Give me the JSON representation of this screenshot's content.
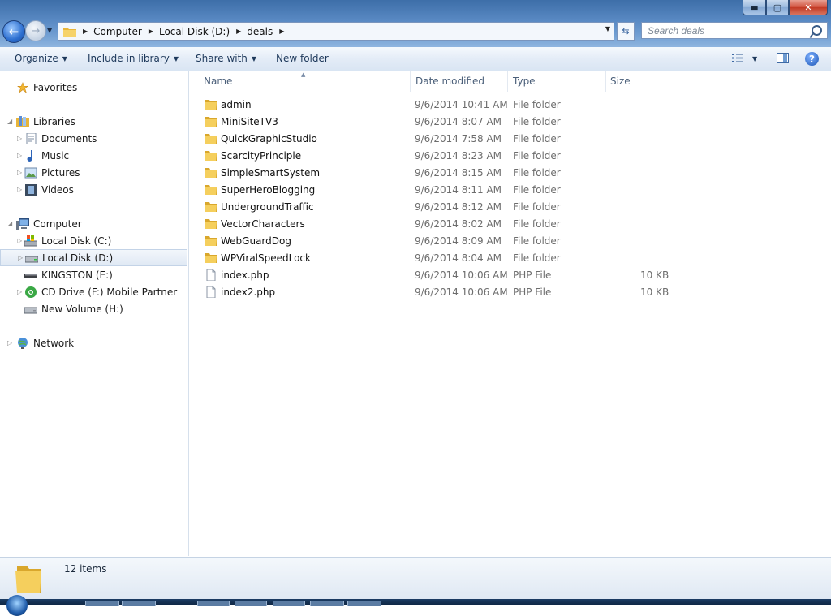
{
  "window": {
    "controls": {
      "minimize": "▬",
      "maximize": "▢",
      "close": "✕"
    }
  },
  "nav": {
    "back_icon": "back-arrow-icon",
    "forward_icon": "forward-arrow-icon"
  },
  "address": {
    "crumbs": [
      "Computer",
      "Local Disk (D:)",
      "deals"
    ]
  },
  "search": {
    "placeholder": "Search deals"
  },
  "toolbar": {
    "organize": "Organize",
    "include": "Include in library",
    "share": "Share with",
    "new_folder": "New folder"
  },
  "sidebar": {
    "favorites": "Favorites",
    "libraries": "Libraries",
    "documents": "Documents",
    "music": "Music",
    "pictures": "Pictures",
    "videos": "Videos",
    "computer": "Computer",
    "drive_c": "Local Disk (C:)",
    "drive_d": "Local Disk (D:)",
    "drive_e": "KINGSTON (E:)",
    "drive_f": "CD Drive (F:) Mobile Partner",
    "drive_h": "New Volume (H:)",
    "network": "Network"
  },
  "columns": {
    "name": "Name",
    "date": "Date modified",
    "type": "Type",
    "size": "Size"
  },
  "files": [
    {
      "name": "admin",
      "date": "9/6/2014 10:41 AM",
      "type": "File folder",
      "size": "",
      "kind": "folder"
    },
    {
      "name": "MiniSiteTV3",
      "date": "9/6/2014 8:07 AM",
      "type": "File folder",
      "size": "",
      "kind": "folder"
    },
    {
      "name": "QuickGraphicStudio",
      "date": "9/6/2014 7:58 AM",
      "type": "File folder",
      "size": "",
      "kind": "folder"
    },
    {
      "name": "ScarcityPrinciple",
      "date": "9/6/2014 8:23 AM",
      "type": "File folder",
      "size": "",
      "kind": "folder"
    },
    {
      "name": "SimpleSmartSystem",
      "date": "9/6/2014 8:15 AM",
      "type": "File folder",
      "size": "",
      "kind": "folder"
    },
    {
      "name": "SuperHeroBlogging",
      "date": "9/6/2014 8:11 AM",
      "type": "File folder",
      "size": "",
      "kind": "folder"
    },
    {
      "name": "UndergroundTraffic",
      "date": "9/6/2014 8:12 AM",
      "type": "File folder",
      "size": "",
      "kind": "folder"
    },
    {
      "name": "VectorCharacters",
      "date": "9/6/2014 8:02 AM",
      "type": "File folder",
      "size": "",
      "kind": "folder"
    },
    {
      "name": "WebGuardDog",
      "date": "9/6/2014 8:09 AM",
      "type": "File folder",
      "size": "",
      "kind": "folder"
    },
    {
      "name": "WPViralSpeedLock",
      "date": "9/6/2014 8:04 AM",
      "type": "File folder",
      "size": "",
      "kind": "folder"
    },
    {
      "name": "index.php",
      "date": "9/6/2014 10:06 AM",
      "type": "PHP File",
      "size": "10 KB",
      "kind": "file"
    },
    {
      "name": "index2.php",
      "date": "9/6/2014 10:06 AM",
      "type": "PHP File",
      "size": "10 KB",
      "kind": "file"
    }
  ],
  "status": {
    "count": "12 items"
  },
  "colors": {
    "folder": "#f2c94c",
    "selection": "#dde8f5",
    "accent": "#1e395b"
  }
}
